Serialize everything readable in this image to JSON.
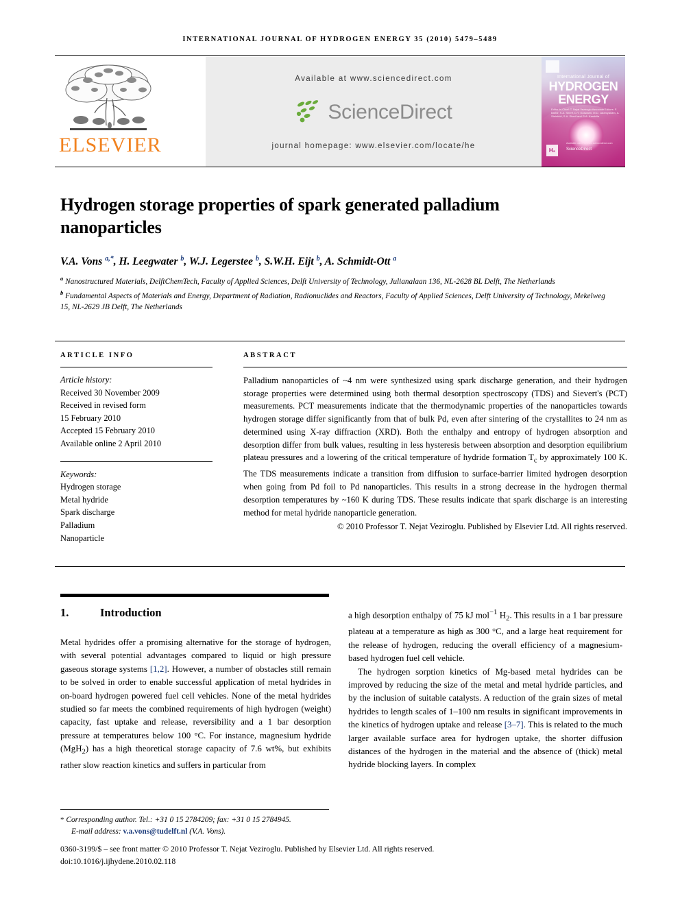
{
  "running_head": "International Journal of Hydrogen Energy 35 (2010) 5479–5489",
  "masthead": {
    "elsevier_wordmark": "ELSEVIER",
    "elsevier_color": "#f1821f",
    "available_at": "Available at www.sciencedirect.com",
    "sciencedirect_logo_text": "ScienceDirect",
    "sciencedirect_logo_color": "#8c8c8c",
    "leaf_color": "#6aab3c",
    "journal_homepage": "journal homepage: www.elsevier.com/locate/he",
    "band_color": "#ececec",
    "cover": {
      "publisher_mark": "ELSEVIER",
      "line1": "International Journal of",
      "line2": "HYDROGEN",
      "line3": "ENERGY",
      "editors": "Editor-in-Chief:  T. Nejat Veziroglu\nAssociate Editors:  F. Barbir, S.A. Sherif, D.Y. Goswami, M.D. Jaraniyanam, A. Steinfeld, S.A. Sherif and G.A. Karakilla",
      "badge": "H₂",
      "sd_mark": "ScienceDirect",
      "sd_mark_top": "Available online at www.sciencedirect.com",
      "accent_color": "#b8267e"
    }
  },
  "article": {
    "title": "Hydrogen storage properties of spark generated palladium nanoparticles",
    "authors_html": "V.A. Vons <sup>a,*</sup>, H. Leegwater <sup>b</sup>, W.J. Legerstee <sup>b</sup>, S.W.H. Eijt <sup>b</sup>, A. Schmidt-Ott <sup>a</sup>",
    "affiliations_html": "<sup>a</sup> Nanostructured Materials, DelftChemTech, Faculty of Applied Sciences, Delft University of Technology, Julianalaan 136, NL-2628 BL Delft, The Netherlands<br><sup>b</sup> Fundamental Aspects of Materials and Energy, Department of Radiation, Radionuclides and Reactors, Faculty of Applied Sciences, Delft University of Technology, Mekelweg 15, NL-2629 JB Delft, The Netherlands"
  },
  "info": {
    "heading": "Article info",
    "history_label": "Article history:",
    "history": [
      "Received 30 November 2009",
      "Received in revised form",
      "15 February 2010",
      "Accepted 15 February 2010",
      "Available online 2 April 2010"
    ],
    "keywords_label": "Keywords:",
    "keywords": [
      "Hydrogen storage",
      "Metal hydride",
      "Spark discharge",
      "Palladium",
      "Nanoparticle"
    ]
  },
  "abstract": {
    "heading": "Abstract",
    "body_html": "Palladium nanoparticles of ~4 nm were synthesized using spark discharge generation, and their hydrogen storage properties were determined using both thermal desorption spectroscopy (TDS) and Sievert's (PCT) measurements. PCT measurements indicate that the thermodynamic properties of the nanoparticles towards hydrogen storage differ significantly from that of bulk Pd, even after sintering of the crystallites to 24 nm as determined using X-ray diffraction (XRD). Both the enthalpy and entropy of hydrogen absorption and desorption differ from bulk values, resulting in less hysteresis between absorption and desorption equilibrium plateau pressures and a lowering of the critical temperature of hydride formation T<sub>c</sub> by approximately 100 K. The TDS measurements indicate a transition from diffusion to surface-barrier limited hydrogen desorption when going from Pd foil to Pd nanoparticles. This results in a strong decrease in the hydrogen thermal desorption temperatures by ~160 K during TDS. These results indicate that spark discharge is an interesting method for metal hydride nanoparticle generation.",
    "copyright": "© 2010 Professor T. Nejat Veziroglu. Published by Elsevier Ltd. All rights reserved."
  },
  "body": {
    "section_number": "1.",
    "section_title": "Introduction",
    "left_html": "Metal hydrides offer a promising alternative for the storage of hydrogen, with several potential advantages compared to liquid or high pressure gaseous storage systems <span class=\"cite\">[1,2]</span>. However, a number of obstacles still remain to be solved in order to enable successful application of metal hydrides in on-board hydrogen powered fuel cell vehicles. None of the metal hydrides studied so far meets the combined requirements of high hydrogen (weight) capacity, fast uptake and release, reversibility and a 1 bar desorption pressure at temperatures below 100 °C. For instance, magnesium hydride (MgH<sub>2</sub>) has a high theoretical storage capacity of 7.6 wt%, but exhibits rather slow reaction kinetics and suffers in particular from",
    "right_para1_html": "a high desorption enthalpy of 75 kJ mol<sup>−1</sup> H<sub>2</sub>. This results in a 1 bar pressure plateau at a temperature as high as 300 °C, and a large heat requirement for the release of hydrogen, reducing the overall efficiency of a magnesium-based hydrogen fuel cell vehicle.",
    "right_para2_html": "The hydrogen sorption kinetics of Mg-based metal hydrides can be improved by reducing the size of the metal and metal hydride particles, and by the inclusion of suitable catalysts. A reduction of the grain sizes of metal hydrides to length scales of 1–100 nm results in significant improvements in the kinetics of hydrogen uptake and release <span class=\"cite\">[3–7]</span>. This is related to the much larger available surface area for hydrogen uptake, the shorter diffusion distances of the hydrogen in the material and the absence of (thick) metal hydride blocking layers. In complex"
  },
  "footer": {
    "corresponding_html": "<span class=\"fn-ital\">Corresponding author. Tel.: +31 0 15 2784209; fax: +31 0 15 2784945.</span>",
    "email_label": "E-mail address:",
    "email": "v.a.vons@tudelft.nl",
    "email_owner": "(V.A. Vons).",
    "issn_line": "0360-3199/$ – see front matter © 2010 Professor T. Nejat Veziroglu. Published by Elsevier Ltd. All rights reserved.",
    "doi": "doi:10.1016/j.ijhydene.2010.02.118",
    "link_color": "#1a3a7a"
  }
}
